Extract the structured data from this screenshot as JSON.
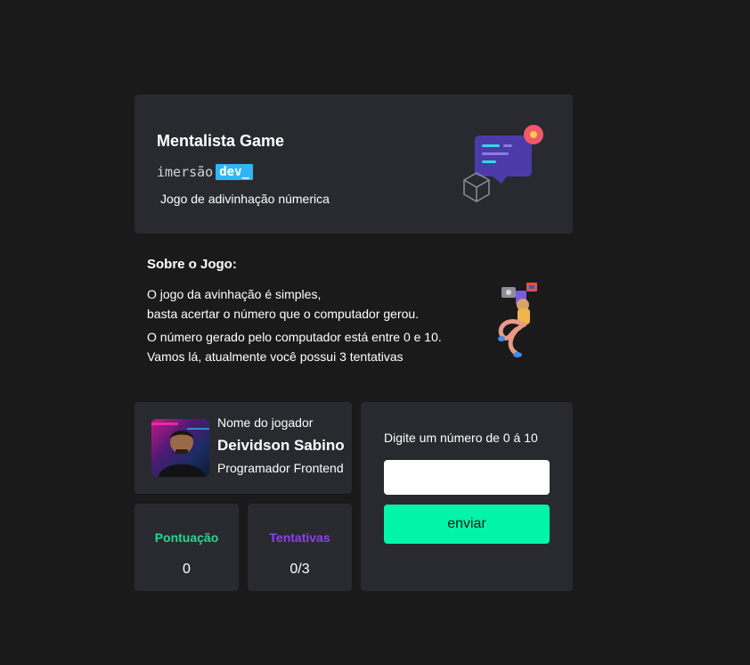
{
  "colors": {
    "background": "#1a1a1b",
    "card": "#282a30",
    "accent_blue": "#2fb6f5",
    "accent_green": "#00f5a8",
    "score_green": "#2ad68f",
    "tries_purple": "#8a42e6"
  },
  "header": {
    "title": "Mentalista Game",
    "brand_word": "imersão",
    "brand_tag": "dev_",
    "subtitle": "Jogo de adivinhação númerica",
    "illustration": "chat-bubble-icon"
  },
  "about": {
    "title": "Sobre o Jogo:",
    "paragraph1_line1": "O jogo da avinhação é simples,",
    "paragraph1_line2": "basta acertar o número que o computador gerou.",
    "paragraph2_line1": "O número gerado pelo computador está entre 0 e 10.",
    "paragraph2_line2": "Vamos lá, atualmente você possui 3 tentativas",
    "illustration": "person-with-laptop-icon"
  },
  "player": {
    "label": "Nome do jogador",
    "name": "Deividson Sabino",
    "role": "Programador Frontend"
  },
  "stats": {
    "score_label": "Pontuação",
    "score_value": "0",
    "tries_label": "Tentativas",
    "tries_value": "0/3"
  },
  "guess": {
    "label": "Digite um número de 0 á 10",
    "input_value": "",
    "button_label": "enviar"
  }
}
